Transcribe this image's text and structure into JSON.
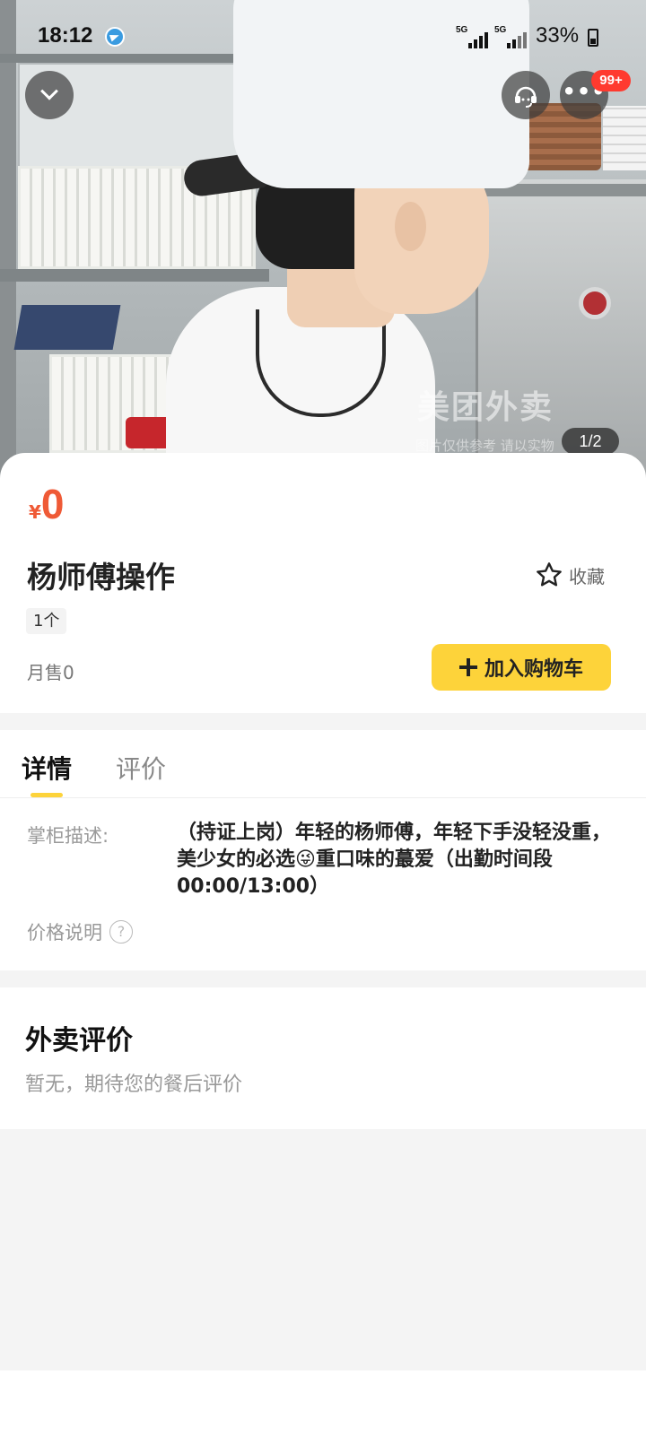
{
  "status_bar": {
    "time": "18:12",
    "signal1_label": "5G",
    "signal2_label": "5G",
    "battery": "33%"
  },
  "hero": {
    "watermark": "美团外卖",
    "watermark_sub": "图片仅供参考 请以实物",
    "pager": "1/2",
    "notification_badge": "99+"
  },
  "product": {
    "currency": "¥",
    "price": "0",
    "name": "杨师傅操作",
    "favorite_label": "收藏",
    "unit": "1个",
    "monthly_sales": "月售0",
    "add_to_cart": "加入购物车"
  },
  "tabs": [
    {
      "label": "详情",
      "active": true
    },
    {
      "label": "评价",
      "active": false
    }
  ],
  "details": {
    "description_label": "掌柜描述:",
    "description_text": "（持证上岗）年轻的杨师傅，年轻下手没轻没重，美少女的必选😜重口味的蕞爱（出勤时间段00:00/13:00）",
    "price_note_label": "价格说明",
    "price_note_icon": "?"
  },
  "reviews": {
    "title": "外卖评价",
    "empty_text": "暂无，期待您的餐后评价"
  },
  "colors": {
    "price": "#ef5a36",
    "accent_yellow": "#fdd33a",
    "badge_red": "#ff3a2f"
  }
}
